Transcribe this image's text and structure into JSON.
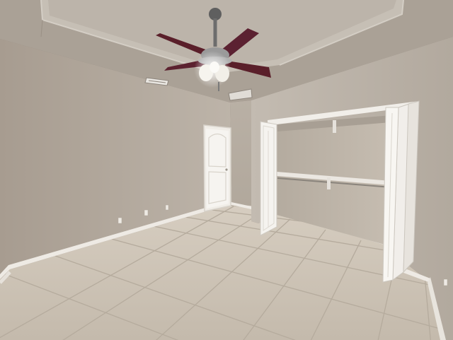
{
  "scene": {
    "kind": "photo",
    "subject": "empty bedroom",
    "colors": {
      "wall": "#b8aea3",
      "ceiling": "#b3aba1",
      "tray": "#c4bdb3",
      "trim": "#f3f1ec",
      "floor": "#cfc6b9",
      "grout": "#b5ab9d",
      "blade": "#5a1f2a",
      "metal": "#9a9a9a",
      "glass": "#f4f1ea"
    }
  },
  "objects": [
    {
      "name": "ceiling-fan",
      "icon": "ceiling-fan-icon"
    },
    {
      "name": "interior-door",
      "icon": "door-icon"
    },
    {
      "name": "closet-bifold-doors",
      "icon": "closet-icon"
    },
    {
      "name": "closet-rod",
      "icon": "rod-icon"
    },
    {
      "name": "tile-floor",
      "icon": "tile-icon"
    },
    {
      "name": "air-vent",
      "icon": "vent-icon"
    }
  ]
}
